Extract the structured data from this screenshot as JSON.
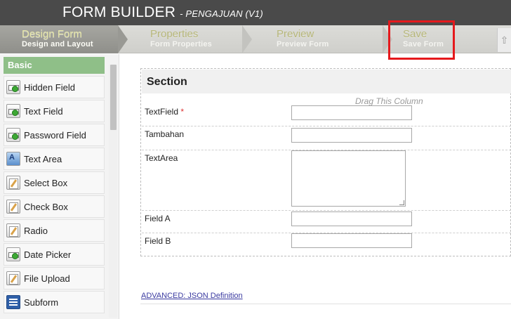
{
  "header": {
    "title": "FORM BUILDER",
    "subtitle": "- PENGAJUAN (V1)"
  },
  "steps": [
    {
      "label": "Design Form",
      "sub": "Design and Layout",
      "active": true
    },
    {
      "label": "Properties",
      "sub": "Form Properties",
      "active": false
    },
    {
      "label": "Preview",
      "sub": "Preview Form",
      "active": false
    },
    {
      "label": "Save",
      "sub": "Save Form",
      "active": false,
      "highlighted": true
    }
  ],
  "palette": {
    "category": "Basic",
    "items": [
      {
        "label": "Hidden Field",
        "icon": "hidden-field-icon"
      },
      {
        "label": "Text Field",
        "icon": "text-field-icon"
      },
      {
        "label": "Password Field",
        "icon": "password-field-icon"
      },
      {
        "label": "Text Area",
        "icon": "text-area-icon"
      },
      {
        "label": "Select Box",
        "icon": "select-box-icon"
      },
      {
        "label": "Check Box",
        "icon": "check-box-icon"
      },
      {
        "label": "Radio",
        "icon": "radio-icon"
      },
      {
        "label": "Date Picker",
        "icon": "date-picker-icon"
      },
      {
        "label": "File Upload",
        "icon": "file-upload-icon"
      },
      {
        "label": "Subform",
        "icon": "subform-icon"
      }
    ]
  },
  "canvas": {
    "section_title": "Section",
    "drag_column": "Drag This Column",
    "fields": [
      {
        "label": "TextField",
        "required": "*",
        "type": "text",
        "value": ""
      },
      {
        "label": "Tambahan",
        "type": "text",
        "value": ""
      },
      {
        "label": "TextArea",
        "type": "textarea",
        "value": ""
      },
      {
        "label": "Field A",
        "type": "text",
        "value": ""
      },
      {
        "label": "Field B",
        "type": "text",
        "value": ""
      }
    ]
  },
  "footer": {
    "advanced_link": "ADVANCED: JSON Definition"
  },
  "colors": {
    "highlight": "#e5191c",
    "palette_header": "#8fbf88",
    "titlebar": "#4a4a4a"
  }
}
